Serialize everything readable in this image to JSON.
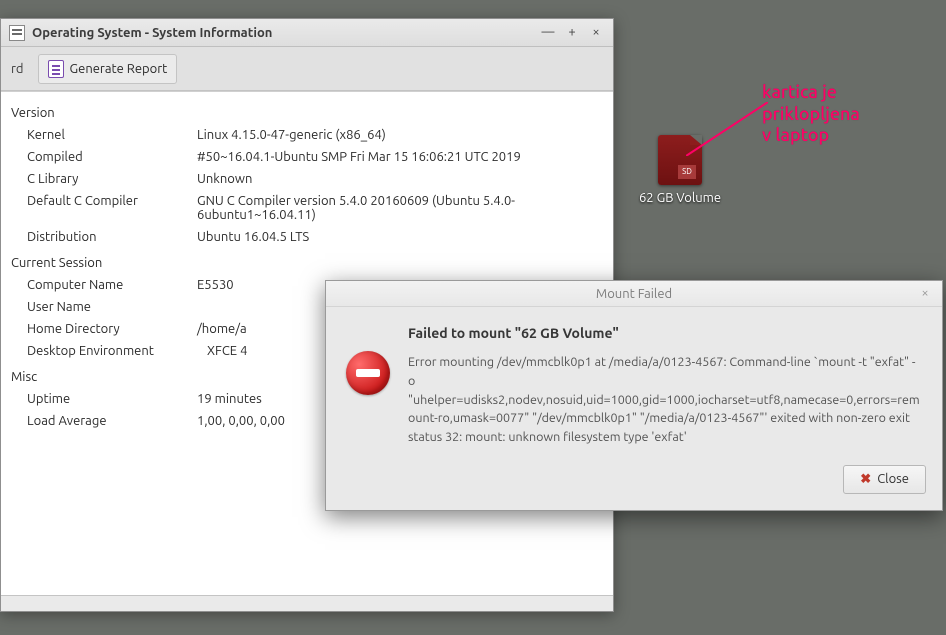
{
  "sysinfo": {
    "title": "Operating System - System Information",
    "toolbar": {
      "leading": "rd",
      "generate_report": "Generate Report"
    },
    "sections": {
      "version": {
        "header": "Version",
        "rows": [
          {
            "key": "Kernel",
            "val": "Linux 4.15.0-47-generic (x86_64)"
          },
          {
            "key": "Compiled",
            "val": "#50~16.04.1-Ubuntu SMP Fri Mar 15 16:06:21 UTC 2019"
          },
          {
            "key": "C Library",
            "val": "Unknown"
          },
          {
            "key": "Default C Compiler",
            "val": "GNU C Compiler version 5.4.0 20160609 (Ubuntu 5.4.0-6ubuntu1~16.04.11)"
          },
          {
            "key": "Distribution",
            "val": "Ubuntu 16.04.5 LTS"
          }
        ]
      },
      "session": {
        "header": "Current Session",
        "rows": [
          {
            "key": "Computer Name",
            "val": "E5530"
          },
          {
            "key": "User Name",
            "val": ""
          },
          {
            "key": "Home Directory",
            "val": "/home/a"
          },
          {
            "key": "Desktop Environment",
            "val": "XFCE 4"
          }
        ]
      },
      "misc": {
        "header": "Misc",
        "rows": [
          {
            "key": "Uptime",
            "val": "19 minutes"
          },
          {
            "key": "Load Average",
            "val": "1,00, 0,00, 0,00"
          }
        ]
      }
    }
  },
  "desktop_icon": {
    "sd_badge": "SD",
    "label": "62 GB Volume"
  },
  "annotation": {
    "line1": "kartica je",
    "line2": "priklopljena",
    "line3": "v laptop"
  },
  "dialog": {
    "title": "Mount Failed",
    "heading": "Failed to mount \"62 GB Volume\"",
    "detail": "Error mounting /dev/mmcblk0p1 at /media/a/0123-4567: Command-line `mount -t \"exfat\" -o \"uhelper=udisks2,nodev,nosuid,uid=1000,gid=1000,iocharset=utf8,namecase=0,errors=remount-ro,umask=0077\" \"/dev/mmcblk0p1\" \"/media/a/0123-4567\"' exited with non-zero exit status 32: mount: unknown filesystem type 'exfat'",
    "close_label": "Close"
  }
}
